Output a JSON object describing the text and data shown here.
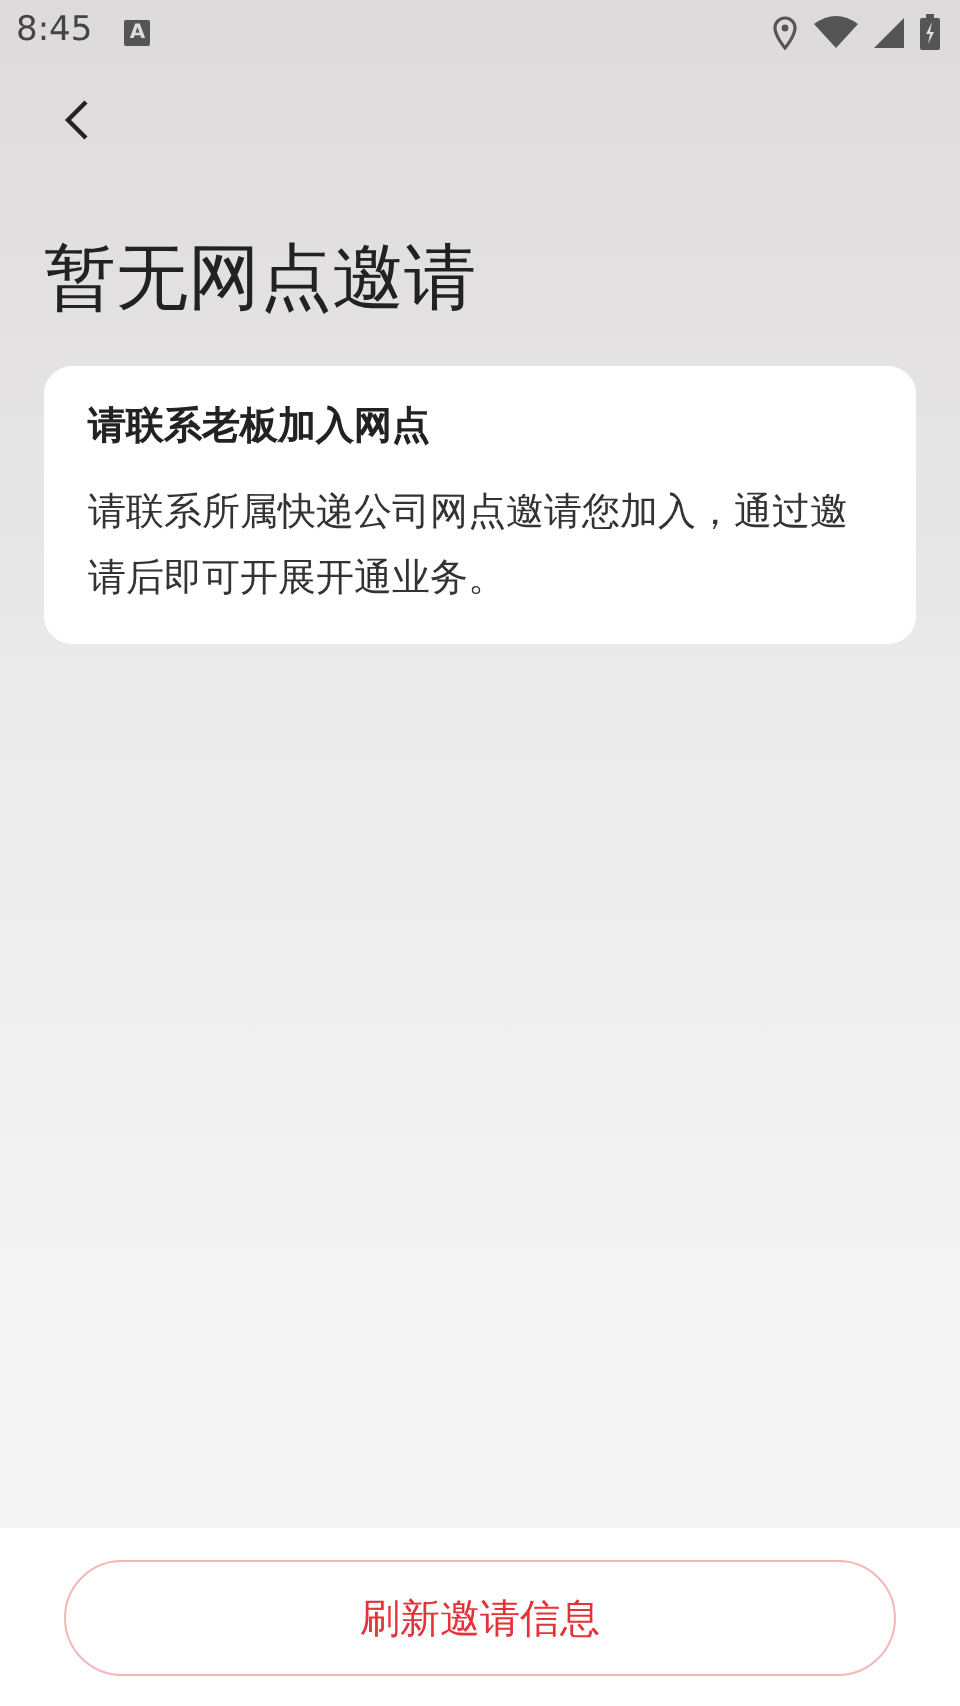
{
  "status_bar": {
    "time": "8:45",
    "notification_letter": "A"
  },
  "title": "暂无网点邀请",
  "card": {
    "heading": "请联系老板加入网点",
    "body": "请联系所属快递公司网点邀请您加入，通过邀请后即可开展开通业务。"
  },
  "footer": {
    "button": "刷新邀请信息"
  }
}
